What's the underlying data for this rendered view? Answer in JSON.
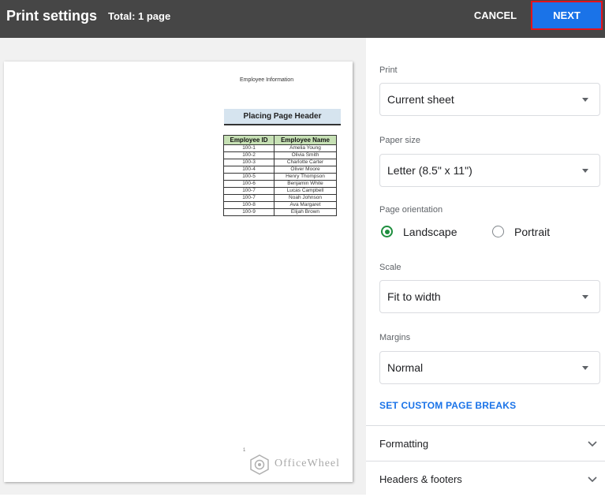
{
  "header": {
    "title": "Print settings",
    "total": "Total: 1 page",
    "cancel_label": "CANCEL",
    "next_label": "NEXT"
  },
  "preview": {
    "doc_header": "Employee Information",
    "sheet_title": "Placing Page Header",
    "table": {
      "columns": [
        "Employee ID",
        "Employee Name"
      ],
      "rows": [
        [
          "100-1",
          "Amelia Young"
        ],
        [
          "100-2",
          "Olivia Smith"
        ],
        [
          "100-3",
          "Charlotte Carter"
        ],
        [
          "100-4",
          "Oliver Moore"
        ],
        [
          "100-5",
          "Henry Thompson"
        ],
        [
          "100-6",
          "Benjamin White"
        ],
        [
          "100-7",
          "Lucas Campbell"
        ],
        [
          "100-7",
          "Noah Johnson"
        ],
        [
          "100-8",
          "Ava Margaret"
        ],
        [
          "100-9",
          "Elijah Brown"
        ]
      ]
    },
    "page_number": "1",
    "watermark_text": "OfficeWheel"
  },
  "settings": {
    "print": {
      "label": "Print",
      "value": "Current sheet"
    },
    "paper_size": {
      "label": "Paper size",
      "value": "Letter (8.5\" x 11\")"
    },
    "orientation": {
      "label": "Page orientation",
      "options": [
        "Landscape",
        "Portrait"
      ],
      "selected": "Landscape"
    },
    "scale": {
      "label": "Scale",
      "value": "Fit to width"
    },
    "margins": {
      "label": "Margins",
      "value": "Normal"
    },
    "custom_breaks_label": "SET CUSTOM PAGE BREAKS",
    "sections": [
      "Formatting",
      "Headers & footers"
    ]
  },
  "colors": {
    "topbar": "#464646",
    "accent": "#1a73e8",
    "radio_selected": "#1e8e3e",
    "highlight_border": "#e3141b"
  },
  "icons": [
    "caret-down-icon",
    "chevron-down-icon",
    "radio-checked-icon",
    "radio-unchecked-icon",
    "officewheel-logo-icon"
  ]
}
